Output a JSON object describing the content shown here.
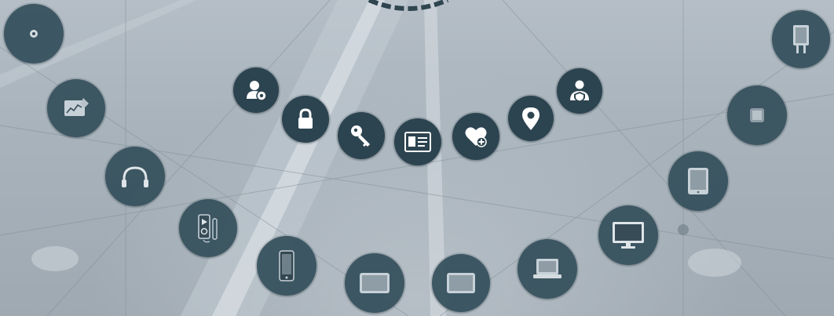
{
  "scene": {
    "background_color": "#a9b4bd",
    "node_color": "#2f4550",
    "icon_color": "#ffffff",
    "accent_color": "#c9d3da"
  },
  "icons": {
    "inner_arc": [
      "user-settings-icon",
      "lock-icon",
      "key-icon",
      "id-card-icon",
      "heart-plus-icon",
      "location-pin-icon",
      "user-shield-icon"
    ],
    "outer_arc": [
      "camera-lens-icon",
      "tablet-chart-icon",
      "headphones-icon",
      "music-player-icon",
      "smartphone-icon",
      "tablet-landscape-icon",
      "tablet-landscape-icon",
      "laptop-icon",
      "desktop-monitor-icon",
      "tablet-portrait-icon",
      "smartwatch-icon",
      "usb-drive-icon"
    ]
  }
}
